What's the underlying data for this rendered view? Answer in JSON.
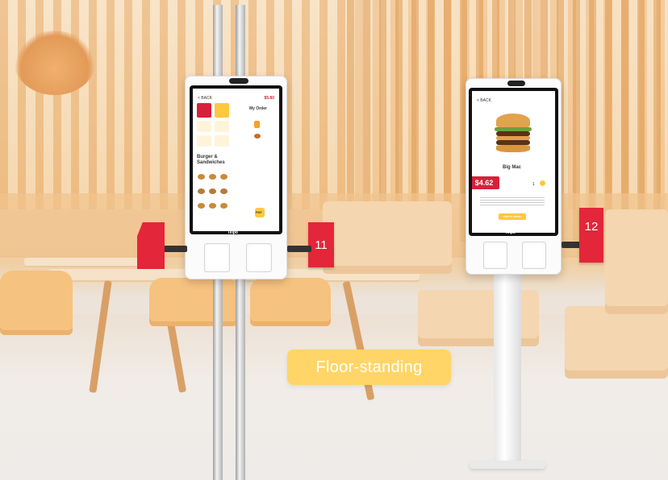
{
  "badge": {
    "label": "Floor-standing"
  },
  "kiosk_left": {
    "back_label": "< BACK",
    "price_top": "$5.80",
    "order_title": "My Order",
    "section_title": "Burger & Sandwiches",
    "brand": "Telpo",
    "table_number": "11",
    "pay_label": "PAY"
  },
  "kiosk_right": {
    "back_label": "< BACK",
    "product_name": "Big Mac",
    "price": "$4.62",
    "quantity": "1",
    "brand": "Telpo",
    "table_number": "12",
    "add_button": "ADD TO ORDER"
  },
  "colors": {
    "accent": "#ffd567",
    "sign_red": "#e3263a",
    "price_red": "#d8203b"
  }
}
